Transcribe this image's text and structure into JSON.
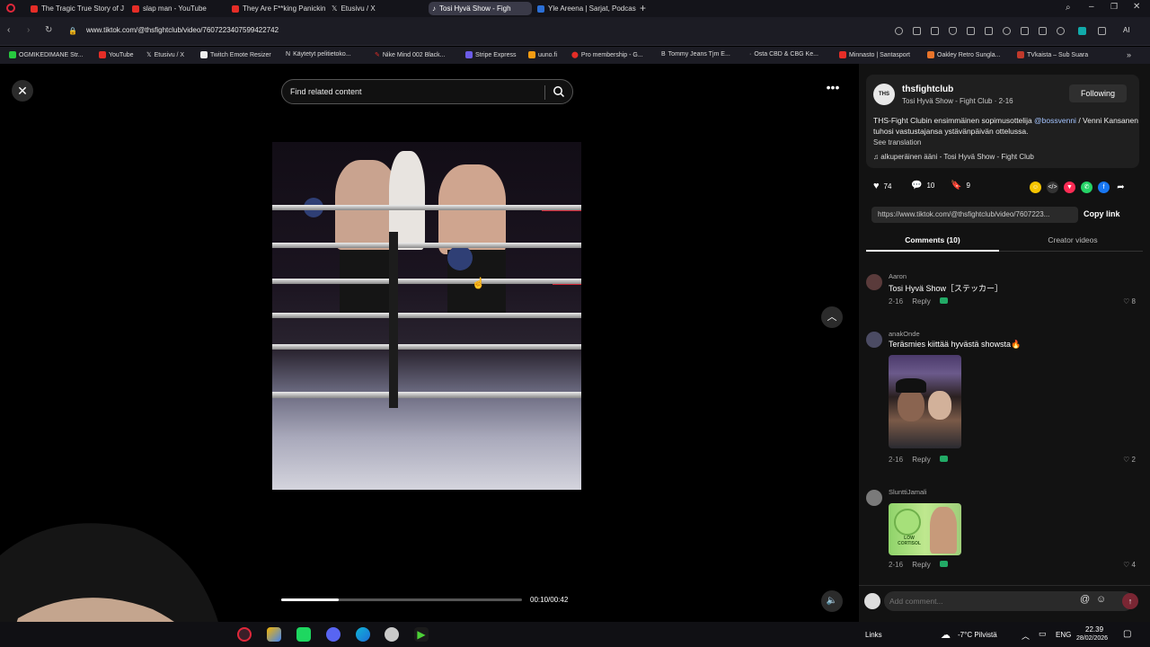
{
  "browser": {
    "tabs": [
      {
        "title": "The Tragic True Story of Ju",
        "color": "#e52d27"
      },
      {
        "title": "slap man - YouTube",
        "color": "#e52d27"
      },
      {
        "title": "They Are F**king Panickin",
        "color": "#e52d27"
      },
      {
        "title": "Etusivu / X",
        "color": "#000000"
      },
      {
        "title": "Tosi Hyvä Show - Figh",
        "color": "#111111"
      },
      {
        "title": "Yle Areena | Sarjat, Podcas",
        "color": "#2b6fd6"
      }
    ],
    "url": "www.tiktok.com/@thsfightclub/video/7607223407599422742",
    "bookmarks": [
      "OGMIKEDIMANE Str...",
      "YouTube",
      "Etusivu / X",
      "Twitch Emote Resizer",
      "Käytetyt pelitietoko...",
      "Nike Mind 002 Black...",
      "Stripe Express",
      "uuno.fi",
      "Pro membership - G...",
      "Tommy Jeans Tjm E...",
      "Osta CBD & CBG Ke...",
      "Minnasto | Santasport",
      "Oakley Retro Sungla...",
      "TVkaista – Sub Suara"
    ]
  },
  "search": {
    "placeholder": "Find related content"
  },
  "video": {
    "progress": 0.24,
    "time": "00:10/00:42"
  },
  "creator": {
    "avatar_text": "THS",
    "username": "thsfightclub",
    "subline": "Tosi Hyvä Show - Fight Club · 2-16",
    "follow_label": "Following",
    "caption_before": "THS-Fight Clubin ensimmäinen sopimusottelija ",
    "caption_mention": "@bossvenni",
    "caption_after": " / Venni Kansanen tuhosi vastustajansa ystävänpäivän ottelussa.",
    "see_translation": "See translation",
    "music": "♫  alkuperäinen ääni - Tosi Hyvä Show - Fight Club"
  },
  "actions": {
    "likes": "74",
    "comments": "10",
    "saves": "9"
  },
  "share_link": {
    "url": "https://www.tiktok.com/@thsfightclub/video/7607223...",
    "copy_label": "Copy link"
  },
  "tabs": {
    "comments": "Comments (10)",
    "creator": "Creator videos"
  },
  "comments": [
    {
      "user": "Aaron",
      "text": "Tosi Hyvä Show［ステッカー］",
      "date": "2-16",
      "reply": "Reply",
      "likes": "8"
    },
    {
      "user": "anakOnde",
      "text": "Teräsmies kiittää hyvästä showsta🔥",
      "date": "2-16",
      "reply": "Reply",
      "likes": "2"
    },
    {
      "user": "SlunttiJamali",
      "text": "",
      "date": "2-16",
      "reply": "Reply",
      "likes": "4"
    }
  ],
  "sticker_text": "LOW\nCORTISOL",
  "comment_box": {
    "placeholder": "Add comment..."
  },
  "taskbar": {
    "links": "Links",
    "weather": "-7°C  Pilvistä",
    "lang": "ENG",
    "time": "22.39",
    "date": "28/02/2026"
  }
}
